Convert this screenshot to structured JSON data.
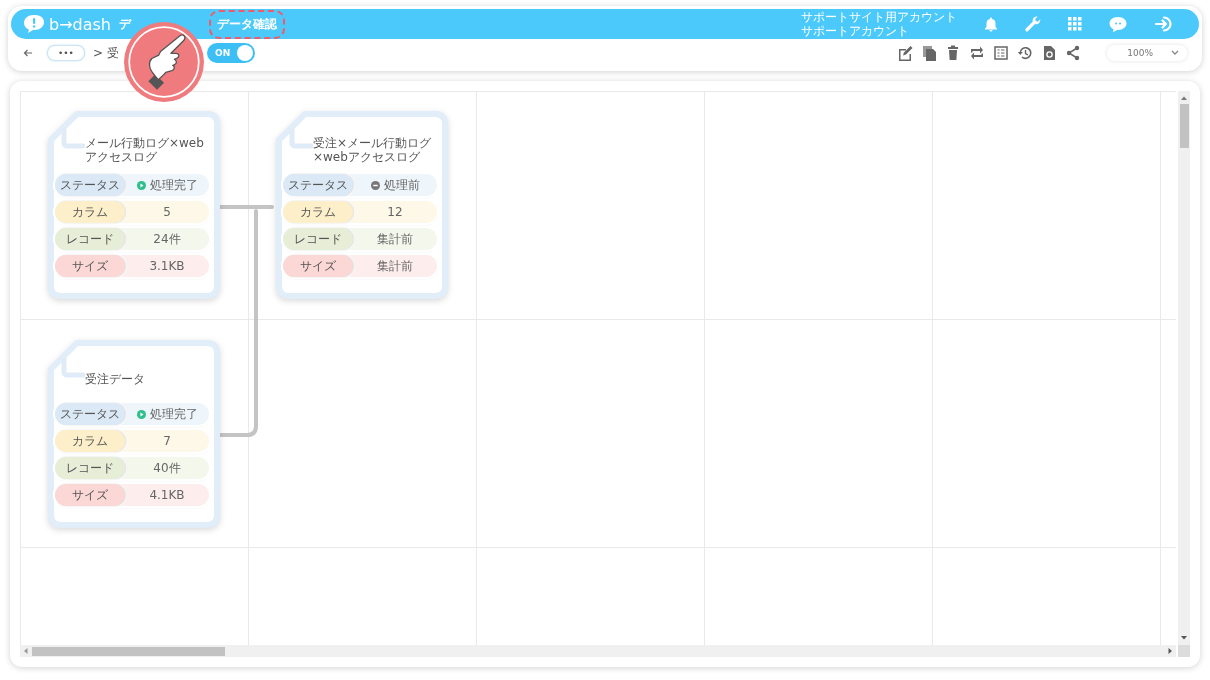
{
  "header": {
    "logo": "b→dash",
    "nav": [
      {
        "label": "デ",
        "selected": false
      },
      {
        "label": "データ確認",
        "selected": true
      }
    ],
    "account": [
      "サポートサイト用アカウント",
      "サポートアカウント"
    ]
  },
  "toolbar": {
    "more": "•••",
    "breadcrumb": [
      ">",
      "受"
    ],
    "toggle": {
      "label": "ON",
      "on": true
    },
    "zoom": "100%"
  },
  "nodes": [
    {
      "title": "メール行動ログ×webアクセスログ",
      "rows": [
        {
          "kind": "status",
          "label": "ステータス",
          "value": "処理完了",
          "done": true
        },
        {
          "kind": "column",
          "label": "カラム",
          "value": "5"
        },
        {
          "kind": "record",
          "label": "レコード",
          "value": "24件"
        },
        {
          "kind": "size",
          "label": "サイズ",
          "value": "3.1KB"
        }
      ]
    },
    {
      "title": "受注×メール行動ログ×webアクセスログ",
      "rows": [
        {
          "kind": "status",
          "label": "ステータス",
          "value": "処理前",
          "done": false
        },
        {
          "kind": "column",
          "label": "カラム",
          "value": "12"
        },
        {
          "kind": "record",
          "label": "レコード",
          "value": "集計前"
        },
        {
          "kind": "size",
          "label": "サイズ",
          "value": "集計前"
        }
      ]
    },
    {
      "title": "受注データ",
      "rows": [
        {
          "kind": "status",
          "label": "ステータス",
          "value": "処理完了",
          "done": true
        },
        {
          "kind": "column",
          "label": "カラム",
          "value": "7"
        },
        {
          "kind": "record",
          "label": "レコード",
          "value": "40件"
        },
        {
          "kind": "size",
          "label": "サイズ",
          "value": "4.1KB"
        }
      ]
    }
  ]
}
